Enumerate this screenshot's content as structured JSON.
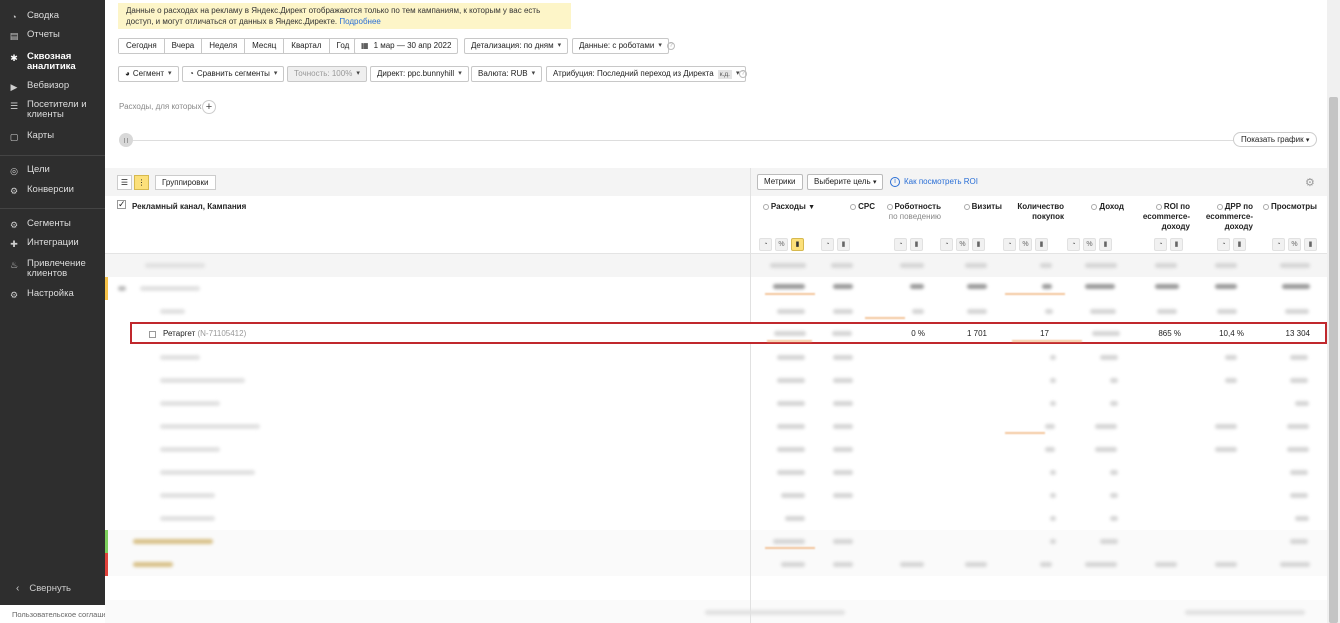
{
  "sidebar": {
    "items": [
      {
        "label": "Сводка",
        "icon": "dashboard-icon",
        "glyph": "◔"
      },
      {
        "label": "Отчеты",
        "icon": "reports-icon",
        "glyph": "▤"
      },
      {
        "label": "Сквозная аналитика",
        "icon": "end-to-end-analytics-icon",
        "glyph": "✱",
        "active": true
      },
      {
        "label": "Вебвизор",
        "icon": "webvisor-icon",
        "glyph": "▶"
      },
      {
        "label": "Посетители и клиенты",
        "icon": "visitors-icon",
        "glyph": "☰"
      },
      {
        "label": "Карты",
        "icon": "maps-icon",
        "glyph": "▢"
      },
      {
        "label": "Цели",
        "icon": "goals-icon",
        "glyph": "◎"
      },
      {
        "label": "Конверсии",
        "icon": "conversions-icon",
        "glyph": "⚙"
      },
      {
        "label": "Сегменты",
        "icon": "segments-icon",
        "glyph": "⚙"
      },
      {
        "label": "Интеграции",
        "icon": "integrations-icon",
        "glyph": "✚"
      },
      {
        "label": "Привлечение клиентов",
        "icon": "acquisition-icon",
        "glyph": "♨"
      },
      {
        "label": "Настройка",
        "icon": "settings-icon",
        "glyph": "⚙"
      }
    ],
    "collapse_label": "Свернуть",
    "footer": "Пользовательское соглашение"
  },
  "notice": {
    "text": "Данные о расходах на рекламу в Яндекс.Директ отображаются только по тем кампаниям, к которым у вас есть доступ, и могут отличаться от данных в Яндекс.Директе. ",
    "link": "Подробнее"
  },
  "toolbar": {
    "periods": [
      "Сегодня",
      "Вчера",
      "Неделя",
      "Месяц",
      "Квартал",
      "Год"
    ],
    "date_range": "1 мар — 30 апр 2022",
    "detail": "Детализация: по дням",
    "data_mode": "Данные: с роботами",
    "segment": "Сегмент",
    "compare": "Сравнить сегменты",
    "accuracy": "Точность: 100%",
    "direct": "Директ: ppc.bunnyhill",
    "currency": "Валюта: RUB",
    "attribution": "Атрибуция: Последний переход из Директа",
    "attribution_tag": "к.д."
  },
  "expenses_for": "Расходы, для которых",
  "show_graph": "Показать график",
  "table": {
    "groupings_label": "Группировки",
    "metrics_label": "Метрики",
    "goal_label": "Выберите цель",
    "roi_link": "Как посмотреть ROI",
    "dimension_title": "Рекламный канал, Кампания",
    "columns": [
      {
        "key": "spend",
        "line1": "Расходы",
        "line2": "",
        "line3": "",
        "sort": "▼"
      },
      {
        "key": "cpc",
        "line1": "CPC",
        "line2": "",
        "line3": ""
      },
      {
        "key": "robots",
        "line1": "Роботность",
        "line2": "по поведению",
        "line3": ""
      },
      {
        "key": "visits",
        "line1": "Визиты",
        "line2": "",
        "line3": ""
      },
      {
        "key": "purchases",
        "line1": "Количество",
        "line2": "покупок",
        "line3": ""
      },
      {
        "key": "revenue",
        "line1": "Доход",
        "line2": "",
        "line3": ""
      },
      {
        "key": "roi",
        "line1": "ROI по",
        "line2": "ecommerce-",
        "line3": "доходу"
      },
      {
        "key": "drr",
        "line1": "ДРР по",
        "line2": "ecommerce-",
        "line3": "доходу"
      },
      {
        "key": "pageviews",
        "line1": "Просмотры",
        "line2": "",
        "line3": ""
      }
    ],
    "highlighted_row": {
      "name": "Ретаргет",
      "id": "(N-71105412)",
      "robots": "0 %",
      "visits": "1 701",
      "purchases": "17",
      "roi": "865 %",
      "drr": "10,4 %",
      "pageviews": "13 304"
    }
  }
}
